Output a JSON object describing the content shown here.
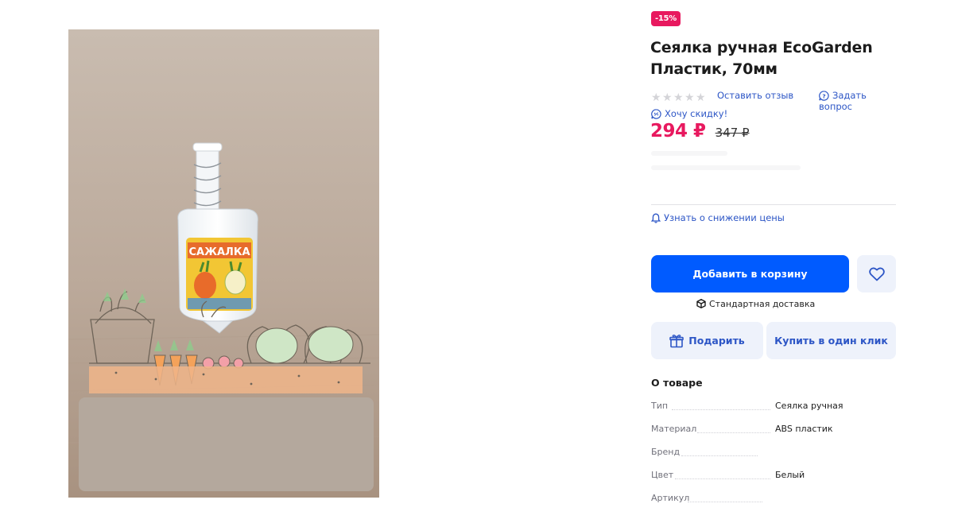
{
  "product": {
    "discount_badge": "-15%",
    "title_line1": "Сеялка ручная EcoGarden",
    "title_line2": "Пластик, 70мм",
    "rating_stars": 0,
    "image_label": "САЖАЛКА"
  },
  "actions": {
    "leave_review": "Оставить отзыв",
    "ask_question": "Задать вопрос",
    "want_discount": "Хочу скидку!",
    "price_watch": "Узнать о снижении цены",
    "add_to_cart": "Добавить в корзину",
    "delivery": "Стандартная доставка",
    "gift": "Подарить",
    "one_click": "Купить в один клик"
  },
  "price": {
    "current": "294 ₽",
    "old": "347 ₽"
  },
  "about": {
    "title": "О товаре",
    "specs": [
      {
        "key": "Тип",
        "value": "Сеялка ручная"
      },
      {
        "key": "Материал",
        "value": "ABS пластик"
      },
      {
        "key": "Бренд",
        "value": ""
      },
      {
        "key": "Цвет",
        "value": "Белый"
      },
      {
        "key": "Артикул",
        "value": ""
      }
    ]
  },
  "colors": {
    "accent_blue": "#005bff",
    "link_blue": "#2d56c6",
    "price_pink": "#e8195f",
    "secondary_button_bg": "#eef2fb"
  },
  "icons": {
    "star": "star-icon",
    "question": "question-bubble-icon",
    "discount": "chat-percent-icon",
    "bell": "bell-icon",
    "heart": "heart-icon",
    "box": "box-icon",
    "gift": "gift-icon"
  }
}
